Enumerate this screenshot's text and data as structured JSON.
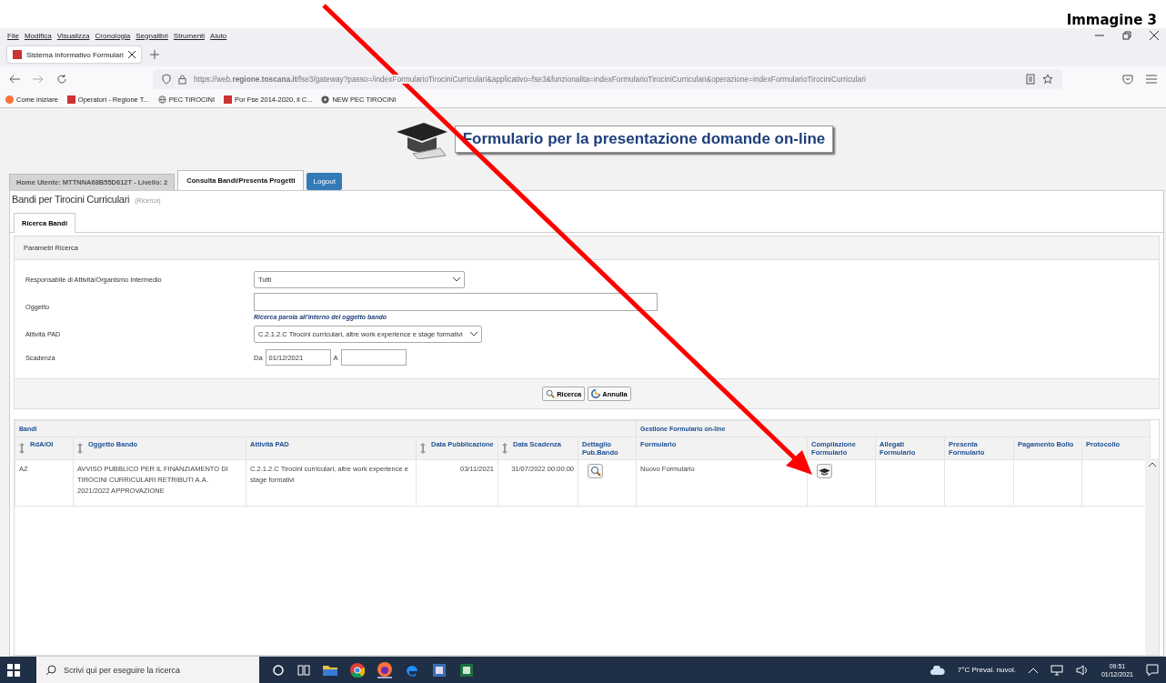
{
  "caption": "Immagine 3",
  "browser": {
    "menu": [
      "File",
      "Modifica",
      "Visualizza",
      "Cronologia",
      "Segnalibri",
      "Strumenti",
      "Aiuto"
    ],
    "tab": {
      "title": "Sistema Informativo Formulari",
      "selected": true
    },
    "url": "https://web.**regione.toscana.it**/fse3/gateway?passo=/indexFormularioTirociniCurriculari&applicativo=fse3&funzionalita=indexFormularioTirociniCurriculari&operazione=indexFormularioTirociniCurriculari",
    "bookmarks": [
      {
        "kind": "firefox",
        "label": "Come iniziare"
      },
      {
        "kind": "region",
        "label": "Operatori - Regione T..."
      },
      {
        "kind": "globe",
        "label": "PEC TIROCINI"
      },
      {
        "kind": "region",
        "label": "Por Fse 2014-2020, il C..."
      },
      {
        "kind": "disc",
        "label": "NEW PEC TIROCINI"
      }
    ]
  },
  "page": {
    "banner_title": "Formulario per la presentazione domande on-line",
    "nav_tabs": [
      {
        "label": "Home Utente: MTTNNA68B55D612T - Livello: 2",
        "kind": "tab",
        "selected": false
      },
      {
        "label": "Consulta Bandi/Presenta Progetti",
        "kind": "tab",
        "selected": true
      },
      {
        "label": "Logout",
        "kind": "button"
      }
    ],
    "heading": "Bandi per Tirocini Curriculari",
    "heading_note": "(Ricerca)",
    "subtab": {
      "label": "Ricerca Bandi",
      "selected": true
    },
    "panel_title": "Parametri Ricerca",
    "fields": [
      {
        "kind": "select",
        "label": "Responsabile di Attività/Organismo Intermedio",
        "value": "Tutti"
      },
      {
        "kind": "text",
        "label": "Oggetto",
        "hint": "Ricerca parola all'interno del oggetto bando"
      },
      {
        "kind": "select-wide",
        "label": "Attività PAD",
        "value": "C.2.1.2.C Tirocini curriculari, altre work experience e stage formativi"
      },
      {
        "kind": "range",
        "label": "Scadenza",
        "from_label": "Da",
        "from": "01/12/2021",
        "to_label": "A"
      }
    ],
    "buttons": [
      {
        "kind": "search",
        "label": "Ricerca"
      },
      {
        "kind": "cancel",
        "label": "Annulla"
      }
    ],
    "table": {
      "group_left": "Bandi",
      "group_right": "Gestione Formulario on-line",
      "columns": [
        {
          "label": "RdA/OI",
          "kind": "sortable"
        },
        {
          "label": "Oggetto Bando",
          "kind": "sortable"
        },
        {
          "label": "Attività PAD",
          "kind": "plain"
        },
        {
          "label": "Data Pubblicazione",
          "kind": "sortable"
        },
        {
          "label": "Data Scadenza",
          "kind": "sortable"
        },
        {
          "label": "Dettaglio Pub.Bando",
          "kind": "plain"
        },
        {
          "label": "Formulario",
          "kind": "plain"
        },
        {
          "label": "Compilazione Formulario",
          "kind": "plain"
        },
        {
          "label": "Allegati Formulario",
          "kind": "plain"
        },
        {
          "label": "Presenta Formulario",
          "kind": "plain"
        },
        {
          "label": "Pagamento Bollo",
          "kind": "plain"
        },
        {
          "label": "Protocollo",
          "kind": "plain"
        }
      ],
      "rows": [
        {
          "cells": [
            {
              "kind": "text",
              "text": "AZ"
            },
            {
              "kind": "text",
              "text": "AVVISO PUBBLICO PER IL FINANZIAMENTO DI TIROCINI CURRICULARI RETRIBUTI A.A. 2021/2022 APPROVAZIONE"
            },
            {
              "kind": "text",
              "text": "C.2.1.2.C Tirocini curriculari, altre work experience e stage formativi"
            },
            {
              "kind": "date",
              "text": "03/11/2021"
            },
            {
              "kind": "date",
              "text": "31/07/2022 00:00:00"
            },
            {
              "kind": "view"
            },
            {
              "kind": "text",
              "text": "Nuovo Formulario"
            },
            {
              "kind": "compile"
            },
            {
              "kind": "empty"
            },
            {
              "kind": "empty"
            },
            {
              "kind": "empty"
            },
            {
              "kind": "empty"
            }
          ]
        }
      ]
    }
  },
  "taskbar": {
    "search_placeholder": "Scrivi qui per eseguire la ricerca",
    "weather": "7°C  Preval. nuvol.",
    "time": "09:51",
    "date": "01/12/2021"
  }
}
